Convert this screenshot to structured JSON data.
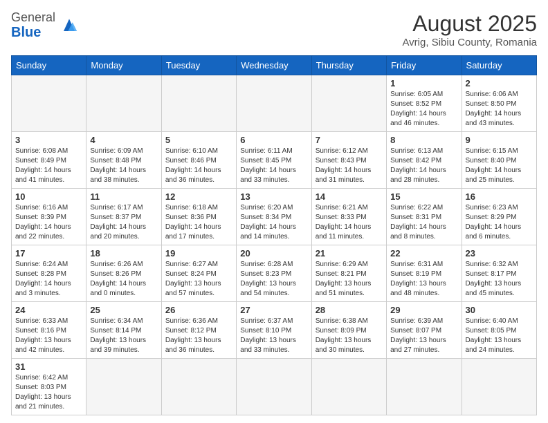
{
  "header": {
    "logo_general": "General",
    "logo_blue": "Blue",
    "title": "August 2025",
    "subtitle": "Avrig, Sibiu County, Romania"
  },
  "weekdays": [
    "Sunday",
    "Monday",
    "Tuesday",
    "Wednesday",
    "Thursday",
    "Friday",
    "Saturday"
  ],
  "weeks": [
    [
      {
        "day": null,
        "empty": true
      },
      {
        "day": null,
        "empty": true
      },
      {
        "day": null,
        "empty": true
      },
      {
        "day": null,
        "empty": true
      },
      {
        "day": null,
        "empty": true
      },
      {
        "day": 1,
        "sunrise": "6:05 AM",
        "sunset": "8:52 PM",
        "daylight": "14 hours and 46 minutes."
      },
      {
        "day": 2,
        "sunrise": "6:06 AM",
        "sunset": "8:50 PM",
        "daylight": "14 hours and 43 minutes."
      }
    ],
    [
      {
        "day": 3,
        "sunrise": "6:08 AM",
        "sunset": "8:49 PM",
        "daylight": "14 hours and 41 minutes."
      },
      {
        "day": 4,
        "sunrise": "6:09 AM",
        "sunset": "8:48 PM",
        "daylight": "14 hours and 38 minutes."
      },
      {
        "day": 5,
        "sunrise": "6:10 AM",
        "sunset": "8:46 PM",
        "daylight": "14 hours and 36 minutes."
      },
      {
        "day": 6,
        "sunrise": "6:11 AM",
        "sunset": "8:45 PM",
        "daylight": "14 hours and 33 minutes."
      },
      {
        "day": 7,
        "sunrise": "6:12 AM",
        "sunset": "8:43 PM",
        "daylight": "14 hours and 31 minutes."
      },
      {
        "day": 8,
        "sunrise": "6:13 AM",
        "sunset": "8:42 PM",
        "daylight": "14 hours and 28 minutes."
      },
      {
        "day": 9,
        "sunrise": "6:15 AM",
        "sunset": "8:40 PM",
        "daylight": "14 hours and 25 minutes."
      }
    ],
    [
      {
        "day": 10,
        "sunrise": "6:16 AM",
        "sunset": "8:39 PM",
        "daylight": "14 hours and 22 minutes."
      },
      {
        "day": 11,
        "sunrise": "6:17 AM",
        "sunset": "8:37 PM",
        "daylight": "14 hours and 20 minutes."
      },
      {
        "day": 12,
        "sunrise": "6:18 AM",
        "sunset": "8:36 PM",
        "daylight": "14 hours and 17 minutes."
      },
      {
        "day": 13,
        "sunrise": "6:20 AM",
        "sunset": "8:34 PM",
        "daylight": "14 hours and 14 minutes."
      },
      {
        "day": 14,
        "sunrise": "6:21 AM",
        "sunset": "8:33 PM",
        "daylight": "14 hours and 11 minutes."
      },
      {
        "day": 15,
        "sunrise": "6:22 AM",
        "sunset": "8:31 PM",
        "daylight": "14 hours and 8 minutes."
      },
      {
        "day": 16,
        "sunrise": "6:23 AM",
        "sunset": "8:29 PM",
        "daylight": "14 hours and 6 minutes."
      }
    ],
    [
      {
        "day": 17,
        "sunrise": "6:24 AM",
        "sunset": "8:28 PM",
        "daylight": "14 hours and 3 minutes."
      },
      {
        "day": 18,
        "sunrise": "6:26 AM",
        "sunset": "8:26 PM",
        "daylight": "14 hours and 0 minutes."
      },
      {
        "day": 19,
        "sunrise": "6:27 AM",
        "sunset": "8:24 PM",
        "daylight": "13 hours and 57 minutes."
      },
      {
        "day": 20,
        "sunrise": "6:28 AM",
        "sunset": "8:23 PM",
        "daylight": "13 hours and 54 minutes."
      },
      {
        "day": 21,
        "sunrise": "6:29 AM",
        "sunset": "8:21 PM",
        "daylight": "13 hours and 51 minutes."
      },
      {
        "day": 22,
        "sunrise": "6:31 AM",
        "sunset": "8:19 PM",
        "daylight": "13 hours and 48 minutes."
      },
      {
        "day": 23,
        "sunrise": "6:32 AM",
        "sunset": "8:17 PM",
        "daylight": "13 hours and 45 minutes."
      }
    ],
    [
      {
        "day": 24,
        "sunrise": "6:33 AM",
        "sunset": "8:16 PM",
        "daylight": "13 hours and 42 minutes."
      },
      {
        "day": 25,
        "sunrise": "6:34 AM",
        "sunset": "8:14 PM",
        "daylight": "13 hours and 39 minutes."
      },
      {
        "day": 26,
        "sunrise": "6:36 AM",
        "sunset": "8:12 PM",
        "daylight": "13 hours and 36 minutes."
      },
      {
        "day": 27,
        "sunrise": "6:37 AM",
        "sunset": "8:10 PM",
        "daylight": "13 hours and 33 minutes."
      },
      {
        "day": 28,
        "sunrise": "6:38 AM",
        "sunset": "8:09 PM",
        "daylight": "13 hours and 30 minutes."
      },
      {
        "day": 29,
        "sunrise": "6:39 AM",
        "sunset": "8:07 PM",
        "daylight": "13 hours and 27 minutes."
      },
      {
        "day": 30,
        "sunrise": "6:40 AM",
        "sunset": "8:05 PM",
        "daylight": "13 hours and 24 minutes."
      }
    ],
    [
      {
        "day": 31,
        "sunrise": "6:42 AM",
        "sunset": "8:03 PM",
        "daylight": "13 hours and 21 minutes."
      },
      {
        "day": null,
        "empty": true
      },
      {
        "day": null,
        "empty": true
      },
      {
        "day": null,
        "empty": true
      },
      {
        "day": null,
        "empty": true
      },
      {
        "day": null,
        "empty": true
      },
      {
        "day": null,
        "empty": true
      }
    ]
  ]
}
